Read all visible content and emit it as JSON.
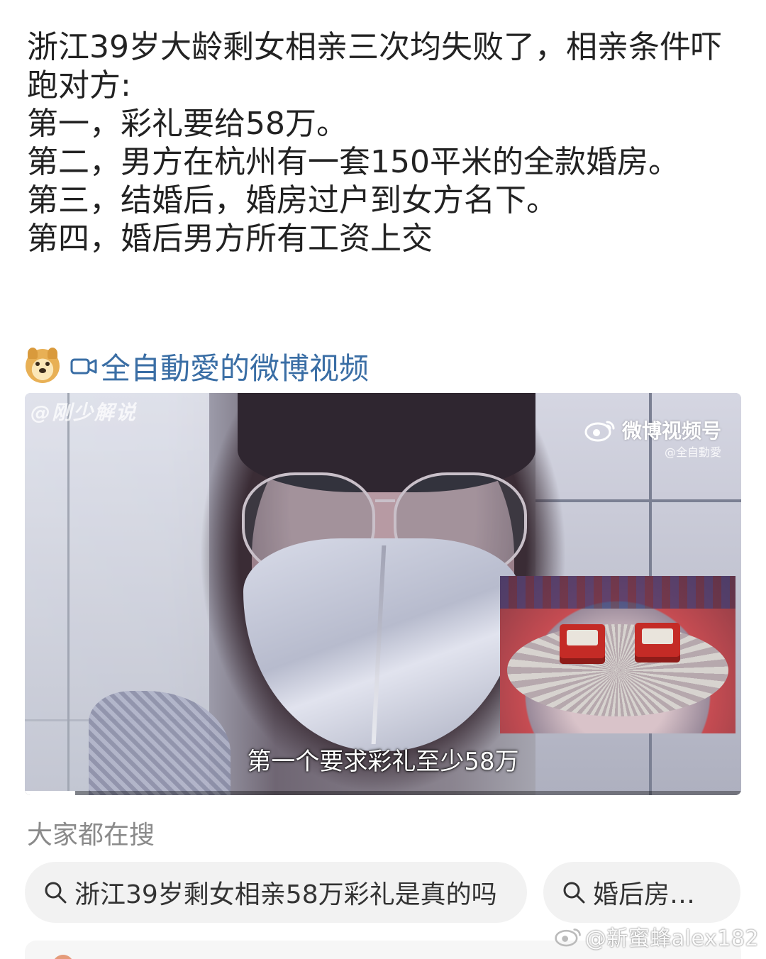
{
  "post": {
    "lines": [
      "浙江39岁大龄剩女相亲三次均失败了，相亲条件吓跑对方:",
      "第一，彩礼要给58万。",
      "第二，男方在杭州有一套150平米的全款婚房。",
      "第三，结婚后，婚房过户到女方名下。",
      "第四，婚后男方所有工资上交"
    ]
  },
  "video_source": {
    "avatar_icon": "doge-icon",
    "camera_icon": "video-camera-icon",
    "label": "全自動愛的微博视频"
  },
  "video": {
    "watermark_top_left": "@刚少解说",
    "brand_name": "微博视频号",
    "brand_handle": "@全自動愛",
    "subtitle": "第一个要求彩礼至少58万",
    "progress": 0.07
  },
  "search": {
    "title": "大家都在搜",
    "chips": [
      {
        "icon": "search-icon",
        "text": "浙江39岁剩女相亲58万彩礼是真的吗"
      },
      {
        "icon": "search-icon",
        "text": "婚后房…"
      }
    ]
  },
  "footer_watermark": "@新蜜蜂alex182",
  "colors": {
    "link_blue": "#3a6ea5",
    "chip_bg": "#f2f2f2",
    "muted_text": "#8a8a8a"
  }
}
